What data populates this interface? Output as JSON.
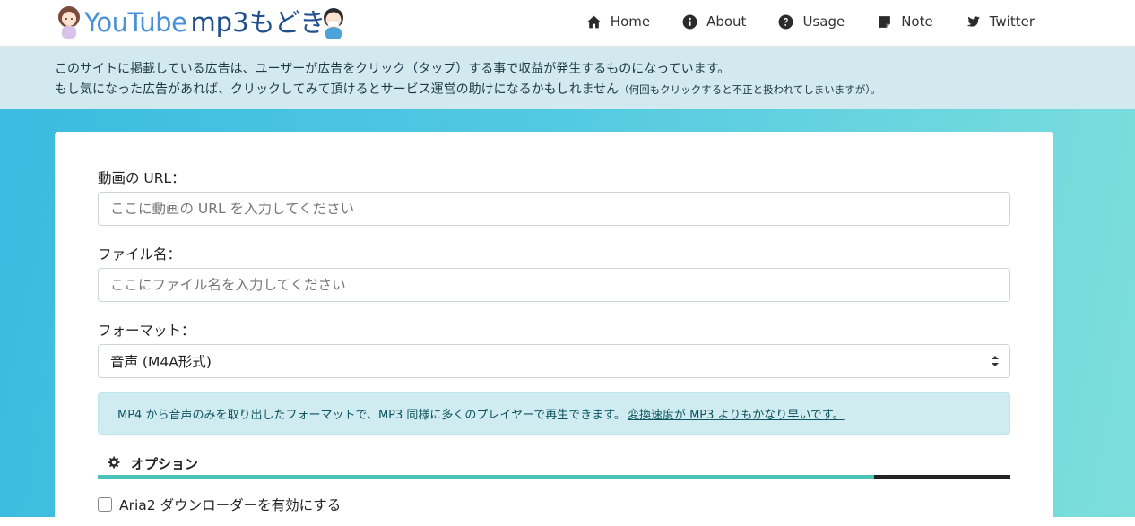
{
  "brand": {
    "youtube": "YouTube",
    "mp3": "mp3もどき"
  },
  "nav": [
    {
      "label": "Home",
      "icon": "home-icon"
    },
    {
      "label": "About",
      "icon": "info-circle-icon"
    },
    {
      "label": "Usage",
      "icon": "question-circle-icon"
    },
    {
      "label": "Note",
      "icon": "note-icon"
    },
    {
      "label": "Twitter",
      "icon": "twitter-icon"
    }
  ],
  "notice": {
    "line1": "このサイトに掲載している広告は、ユーザーが広告をクリック（タップ）する事で収益が発生するものになっています。",
    "line2": "もし気になった広告があれば、クリックしてみて頂けるとサービス運営の助けになるかもしれません",
    "line2_small": "（何回もクリックすると不正と扱われてしまいますが）。"
  },
  "form": {
    "url_label": "動画の URL：",
    "url_placeholder": "ここに動画の URL を入力してください",
    "file_label": "ファイル名：",
    "file_placeholder": "ここにファイル名を入力してください",
    "format_label": "フォーマット：",
    "format_selected": "音声 (M4A形式)"
  },
  "info": {
    "text": "MP4 から音声のみを取り出したフォーマットで、MP3 同様に多くのプレイヤーで再生できます。",
    "link": "変換速度が MP3 よりもかなり早いです。"
  },
  "options": {
    "title": "オプション",
    "aria2_label": "Aria2 ダウンローダーを有効にする"
  },
  "colors": {
    "accent_bar": "#4cc3b6",
    "gradient_start": "#3bbbe0",
    "gradient_end": "#7ddfdc"
  }
}
